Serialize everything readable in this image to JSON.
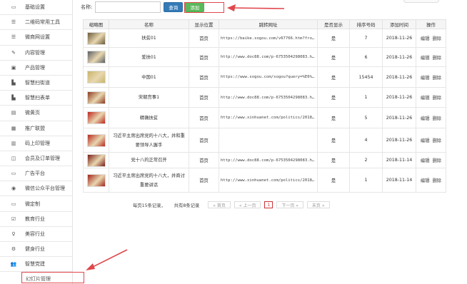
{
  "sidebar": {
    "items": [
      {
        "label": "基础设置",
        "icon": "monitor-icon"
      },
      {
        "label": "二维码常用工具",
        "icon": "list-icon"
      },
      {
        "label": "微商网设置",
        "icon": "list-icon"
      },
      {
        "label": "内容管理",
        "icon": "edit-icon"
      },
      {
        "label": "产品管理",
        "icon": "image-icon"
      },
      {
        "label": "智慧扫街道",
        "icon": "building-icon"
      },
      {
        "label": "智慧扫表单",
        "icon": "building-icon"
      },
      {
        "label": "微黄页",
        "icon": "book-icon"
      },
      {
        "label": "推广联盟",
        "icon": "gift-icon"
      },
      {
        "label": "码上印管理",
        "icon": "barcode-icon"
      },
      {
        "label": "会员及订单管理",
        "icon": "database-icon"
      },
      {
        "label": "广告平台",
        "icon": "monitor-icon"
      },
      {
        "label": "微信公众平台管理",
        "icon": "chat-icon"
      },
      {
        "label": "微定制",
        "icon": "monitor-icon"
      },
      {
        "label": "教育行业",
        "icon": "check-square-icon"
      },
      {
        "label": "美容行业",
        "icon": "female-icon"
      },
      {
        "label": "健身行业",
        "icon": "gears-icon"
      },
      {
        "label": "智慧党建",
        "icon": "users-icon"
      }
    ],
    "sub_item": "幻灯片管理"
  },
  "search": {
    "label": "名称:",
    "value": "",
    "search_button": "查询",
    "add_button": "添加"
  },
  "table": {
    "headers": [
      "缩略图",
      "名称",
      "显示位置",
      "跳转网址",
      "是否显示",
      "排序号码",
      "添加时间",
      "操作"
    ],
    "rows": [
      {
        "name": "扶贫01",
        "position": "首页",
        "url": "https://baike.sogou.com/v67766.htm?fromTi…",
        "show": "是",
        "order": "7",
        "date": "2018-11-26",
        "edit": "编辑",
        "del": "删除",
        "thumb_color": "#6b5a3c"
      },
      {
        "name": "爱扶01",
        "position": "首页",
        "url": "http://www.doc88.com/p-6753504298083.html",
        "show": "是",
        "order": "6",
        "date": "2018-11-26",
        "edit": "编辑",
        "del": "删除",
        "thumb_color": "#5a5f66"
      },
      {
        "name": "中国01",
        "position": "首页",
        "url": "https://www.sogou.com/sogou?query=%E6%B8%B0%…",
        "show": "是",
        "order": "15454",
        "date": "2018-11-26",
        "edit": "编辑",
        "del": "删除",
        "thumb_color": "#c9b56a"
      },
      {
        "name": "宋朝宫事1",
        "position": "首页",
        "url": "http://www.doc88.com/p-6753504298083.html",
        "show": "是",
        "order": "1",
        "date": "2018-11-26",
        "edit": "编辑",
        "del": "删除",
        "thumb_color": "#8c3a20"
      },
      {
        "name": "精确扶贫",
        "position": "首页",
        "url": "http://www.xinhuanet.com/politics/2018-11…",
        "show": "是",
        "order": "5",
        "date": "2018-11-26",
        "edit": "编辑",
        "del": "删除",
        "thumb_color": "#c0241c"
      },
      {
        "name": "习近平主席出席党的十八大，并和重要领导人握手",
        "position": "首页",
        "url": "",
        "show": "是",
        "order": "4",
        "date": "2018-11-26",
        "edit": "编辑",
        "del": "删除",
        "thumb_color": "#b82a1e"
      },
      {
        "name": "党十八的正常召开",
        "position": "首页",
        "url": "http://www.doc88.com/p-6753504298083.html",
        "show": "是",
        "order": "2",
        "date": "2018-11-14",
        "edit": "编辑",
        "del": "删除",
        "thumb_color": "#7a1d16"
      },
      {
        "name": "习近平主席出席党的十八大，并商讨重要讲话",
        "position": "首页",
        "url": "http://www.xinhuanet.com/politics/2018-11…",
        "show": "是",
        "order": "1",
        "date": "2018-11-14",
        "edit": "编辑",
        "del": "删除",
        "thumb_color": "#a3241a"
      }
    ]
  },
  "pager": {
    "per_page": "每页15条记录，",
    "total": "共有8条记录",
    "first": "« 首页",
    "prev": "« 上一页",
    "current": "1",
    "next": "下一页 »",
    "last": "末页 »"
  },
  "colors": {
    "search_button": "#337ab7",
    "add_button": "#5cb85c",
    "annotation": "#e0474c"
  }
}
